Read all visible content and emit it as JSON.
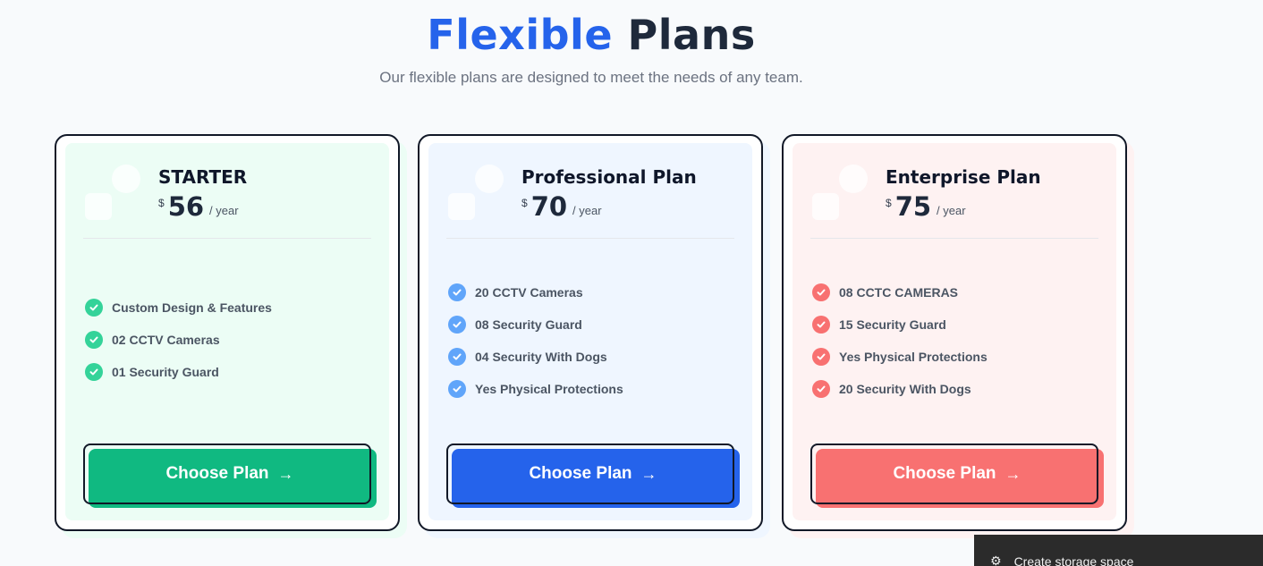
{
  "heading": {
    "accent": "Flexible",
    "rest": "Plans"
  },
  "subtitle": "Our flexible plans are designed to meet the needs of any team.",
  "plans": [
    {
      "title": "STARTER",
      "currency": "$",
      "amount": "56",
      "period": "/ year",
      "features": [
        "Custom Design & Features",
        "02 CCTV Cameras",
        "01 Security Guard"
      ],
      "button_label": "Choose Plan",
      "colors": {
        "bg": "#ecfdf5",
        "accent": "#10b981",
        "check": "#34d399",
        "shadow": "#ecfdf5"
      }
    },
    {
      "title": "Professional Plan",
      "currency": "$",
      "amount": "70",
      "period": "/ year",
      "features": [
        "20 CCTV Cameras",
        "08 Security Guard",
        "04 Security With Dogs",
        "Yes Physical Protections"
      ],
      "button_label": "Choose Plan",
      "colors": {
        "bg": "#eff6ff",
        "accent": "#2563eb",
        "check": "#60a5fa",
        "shadow": "#eff6ff"
      }
    },
    {
      "title": "Enterprise Plan",
      "currency": "$",
      "amount": "75",
      "period": "/ year",
      "features": [
        "08 CCTC CAMERAS",
        "15 Security Guard",
        "Yes Physical Protections",
        "20 Security With Dogs"
      ],
      "button_label": "Choose Plan",
      "colors": {
        "bg": "#fef2f2",
        "accent": "#f87171",
        "check": "#f87171",
        "shadow": "#fef2f2"
      }
    }
  ],
  "toast": {
    "icon": "gear-icon",
    "text": "Create storage space"
  }
}
